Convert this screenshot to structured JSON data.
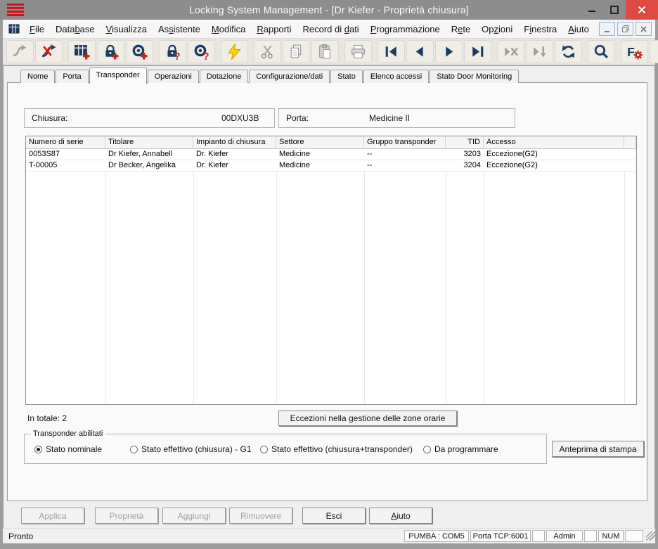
{
  "colors": {
    "accent_navy": "#1c3d63",
    "action_red": "#cf1a1c",
    "titlebar_gray": "#8d8d8d",
    "close_red": "#dd4b43",
    "program_yellow": "#ffd200"
  },
  "titlebar": {
    "title": "Locking System Management - [Dr Kiefer - Proprietà chiusura]",
    "controls": [
      "minimize",
      "maximize",
      "close"
    ]
  },
  "menu": {
    "items": [
      {
        "label": "File",
        "u": 0
      },
      {
        "label": "Database",
        "u": 4
      },
      {
        "label": "Visualizza",
        "u": 0
      },
      {
        "label": "Assistente",
        "u": 2
      },
      {
        "label": "Modifica",
        "u": 0
      },
      {
        "label": "Rapporti",
        "u": 0
      },
      {
        "label": "Record di dati",
        "u": 10
      },
      {
        "label": "Programmazione",
        "u": 0
      },
      {
        "label": "Rete",
        "u": 1
      },
      {
        "label": "Opzioni",
        "u": 2
      },
      {
        "label": "Finestra",
        "u": 1
      },
      {
        "label": "Aiuto",
        "u": 0
      }
    ],
    "mdi_controls": [
      "minimize",
      "restore",
      "close"
    ]
  },
  "toolbar": {
    "groups": [
      [
        "redo",
        "disconnect"
      ],
      [
        "new-locking-system",
        "new-lock",
        "new-transponder"
      ],
      [
        "read-lock",
        "read-transponder"
      ],
      [
        "program"
      ],
      [
        "cut",
        "copy",
        "paste"
      ],
      [
        "print"
      ],
      [
        "first-record",
        "prev-record",
        "next-record",
        "last-record"
      ],
      [
        "cancel-record",
        "post-record",
        "refresh"
      ],
      [
        "search"
      ],
      [
        "filter-settings",
        "help"
      ]
    ],
    "disabled": [
      "redo",
      "cut",
      "copy",
      "paste",
      "print",
      "cancel-record",
      "post-record"
    ]
  },
  "tabs": [
    {
      "label": "Nome",
      "active": false
    },
    {
      "label": "Porta",
      "active": false
    },
    {
      "label": "Transponder",
      "active": true
    },
    {
      "label": "Operazioni",
      "active": false
    },
    {
      "label": "Dotazione",
      "active": false
    },
    {
      "label": "Configurazione/dati",
      "active": false
    },
    {
      "label": "Stato",
      "active": false
    },
    {
      "label": "Elenco accessi",
      "active": false
    },
    {
      "label": "Stato Door Monitoring",
      "active": false
    }
  ],
  "form": {
    "lock_label": "Chiusura:",
    "lock_value": "00DXU3B",
    "door_label": "Porta:",
    "door_value": "Medicine II"
  },
  "table": {
    "columns": [
      "Numero di serie",
      "Titolare",
      "Impianto di chiusura",
      "Settore",
      "Gruppo transponder",
      "TID",
      "Accesso",
      ""
    ],
    "rows": [
      [
        "0053S87",
        "Dr Kiefer, Annabell",
        "Dr. Kiefer",
        "Medicine",
        "--",
        "3203",
        "Eccezione(G2)",
        ""
      ],
      [
        "T-00005",
        "Dr Becker, Angelika",
        "Dr. Kiefer",
        "Medicine",
        "--",
        "3204",
        "Eccezione(G2)",
        ""
      ]
    ]
  },
  "summary": {
    "total": "In totale: 2"
  },
  "actions": {
    "exceptions": "Eccezioni nella gestione delle zone orarie",
    "print_preview": "Anteprima di stampa"
  },
  "radio_group": {
    "title": "Transponder abilitati",
    "options": [
      {
        "label": "Stato nominale",
        "selected": true
      },
      {
        "label": "Stato effettivo (chiusura) - G1",
        "selected": false
      },
      {
        "label": "Stato effettivo (chiusura+transponder)",
        "selected": false
      },
      {
        "label": "Da programmare",
        "selected": false
      }
    ]
  },
  "footer_buttons": [
    {
      "label": "Applica",
      "disabled": true
    },
    {
      "label": "Proprietà",
      "disabled": true
    },
    {
      "label": "Aggiungi",
      "disabled": true
    },
    {
      "label": "Rimuovere",
      "disabled": true
    },
    {
      "label": "Esci",
      "disabled": false
    },
    {
      "label": "Aiuto",
      "disabled": false,
      "u": 0
    }
  ],
  "statusbar": {
    "ready": "Pronto",
    "panels": [
      "PUMBA : COM5",
      "Porta TCP:6001",
      "",
      "Admin",
      "",
      "NUM",
      ""
    ]
  }
}
